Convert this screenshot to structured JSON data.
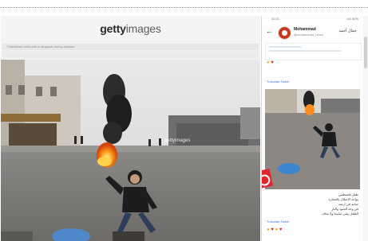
{
  "getty": {
    "logo_bold": "getty",
    "logo_light": "images",
    "bar_text": "Palestinian child with a slingshot during clashes",
    "watermark": "gettyimages"
  },
  "panel": {
    "status_time": "10:21",
    "status_right": "4G 80%",
    "back_icon": "arrow-back",
    "name": "Mohammad",
    "handle": "@mohammad_news",
    "arabic_title": "جمال أحمد",
    "link_top": "Translate Tweet",
    "link_bottom": "Translate Tweet",
    "caption_lines": [
      "طفل فلسطيني",
      "يواجه الاحتلال بالحجارة",
      "صامد في أرضه",
      "في وجه الجنود والنار",
      "الطفل يبقى صامدا ولا يخاف"
    ]
  },
  "colors": {
    "accent_red": "#e3232f",
    "link_blue": "#3b7ad6",
    "heart": "#d62c2c",
    "emoji": "#f2b21c"
  }
}
